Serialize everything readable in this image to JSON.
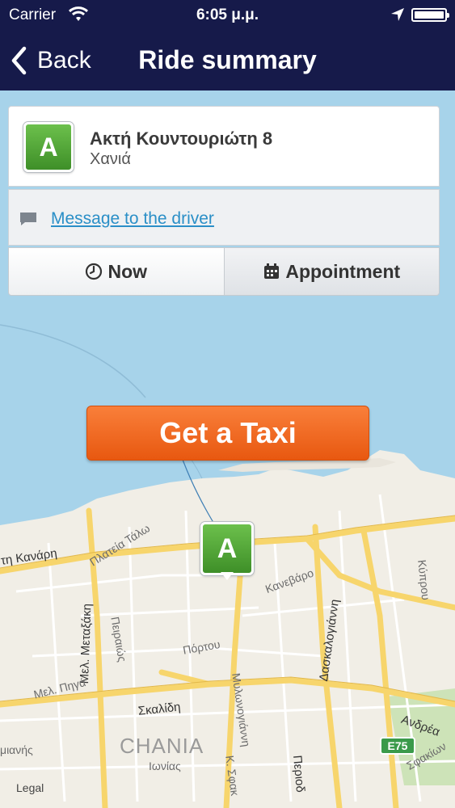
{
  "status_bar": {
    "carrier": "Carrier",
    "time": "6:05 μ.μ."
  },
  "nav": {
    "back_label": "Back",
    "title": "Ride summary"
  },
  "address": {
    "badge": "A",
    "street": "Ακτή Κουντουριώτη 8",
    "city": "Χανιά"
  },
  "message": {
    "link": "Message to the driver",
    "icon": "speech-bubble-icon"
  },
  "timing": {
    "now_label": "Now",
    "appointment_label": "Appointment",
    "selected": "Now"
  },
  "action": {
    "get_taxi_label": "Get a Taxi"
  },
  "map": {
    "pin_label": "A",
    "labels": [
      "Πλατεία Τάλω",
      "τη Κανάρη",
      "Μελ. Μεταξάκη",
      "Πειραιώς",
      "Κανεβάρο",
      "Δασκαλογιάννη",
      "Πόρτου",
      "Κύπρου",
      "Μελ. Πηγά",
      "Μυλωνογιάννη",
      "Σκαλίδη",
      "Ανδρέα",
      "μιανής",
      "Ιωνίας",
      "Κ. Σφακ",
      "Περιοδ",
      "Σφακίων"
    ],
    "city_name": "CHANIA",
    "road_shield": "E75",
    "legal": "Legal"
  },
  "colors": {
    "nav_bg": "#161a4a",
    "link": "#2a8fc7",
    "taxi_button": "#f26a22",
    "badge_green": "#55a83a",
    "sea": "#a7d3ea",
    "land": "#f1eee6",
    "road": "#f7d56c"
  }
}
